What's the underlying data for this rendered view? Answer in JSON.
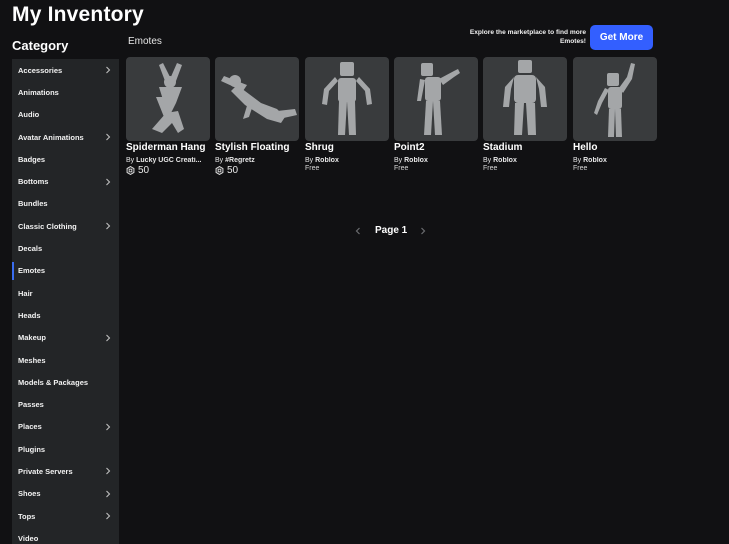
{
  "header": {
    "title": "My Inventory"
  },
  "sidebar": {
    "title": "Category",
    "items": [
      {
        "label": "Accessories",
        "chevron": true
      },
      {
        "label": "Animations",
        "chevron": false
      },
      {
        "label": "Audio",
        "chevron": false
      },
      {
        "label": "Avatar Animations",
        "chevron": true
      },
      {
        "label": "Badges",
        "chevron": false
      },
      {
        "label": "Bottoms",
        "chevron": true
      },
      {
        "label": "Bundles",
        "chevron": false
      },
      {
        "label": "Classic Clothing",
        "chevron": true
      },
      {
        "label": "Decals",
        "chevron": false
      },
      {
        "label": "Emotes",
        "chevron": false,
        "active": true
      },
      {
        "label": "Hair",
        "chevron": false
      },
      {
        "label": "Heads",
        "chevron": false
      },
      {
        "label": "Makeup",
        "chevron": true
      },
      {
        "label": "Meshes",
        "chevron": false
      },
      {
        "label": "Models & Packages",
        "chevron": false
      },
      {
        "label": "Passes",
        "chevron": false
      },
      {
        "label": "Places",
        "chevron": true
      },
      {
        "label": "Plugins",
        "chevron": false
      },
      {
        "label": "Private Servers",
        "chevron": true
      },
      {
        "label": "Shoes",
        "chevron": true
      },
      {
        "label": "Tops",
        "chevron": true
      },
      {
        "label": "Video",
        "chevron": false
      }
    ]
  },
  "main": {
    "section_title": "Emotes",
    "promo": {
      "text": "Explore the marketplace to find more Emotes!",
      "button_label": "Get More"
    },
    "items": [
      {
        "name": "Spiderman Hang",
        "by_prefix": "By",
        "creator": "Lucky UGC Creati...",
        "robux": "50",
        "icon": "spiderman-hang-icon"
      },
      {
        "name": "Stylish Floating",
        "by_prefix": "By",
        "creator": "#Regretz",
        "robux": "50",
        "icon": "stylish-floating-icon"
      },
      {
        "name": "Shrug",
        "by_prefix": "By",
        "creator": "Roblox",
        "price": "Free",
        "icon": "shrug-icon"
      },
      {
        "name": "Point2",
        "by_prefix": "By",
        "creator": "Roblox",
        "price": "Free",
        "icon": "point-icon"
      },
      {
        "name": "Stadium",
        "by_prefix": "By",
        "creator": "Roblox",
        "price": "Free",
        "icon": "stadium-icon"
      },
      {
        "name": "Hello",
        "by_prefix": "By",
        "creator": "Roblox",
        "price": "Free",
        "icon": "wave-icon"
      }
    ],
    "pagination": {
      "label": "Page 1"
    }
  },
  "colors": {
    "background": "#111113",
    "sidebar": "#232527",
    "accent": "#335fff",
    "thumb": "#393b3d",
    "figure": "#a4a6a8"
  }
}
